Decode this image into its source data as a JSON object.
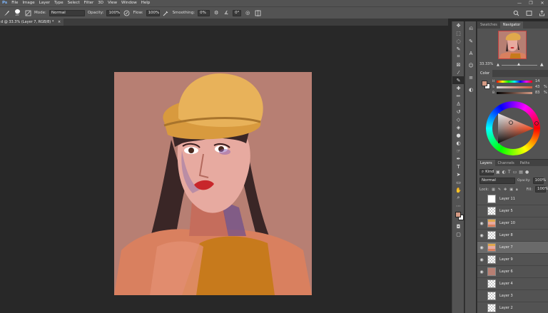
{
  "menu": [
    "File",
    "Image",
    "Layer",
    "Type",
    "Select",
    "Filter",
    "3D",
    "View",
    "Window",
    "Help"
  ],
  "window_controls": [
    "—",
    "❐",
    "✕"
  ],
  "options": {
    "brush_size": "20",
    "mode_label": "Mode:",
    "mode_value": "Normal",
    "opacity_label": "Opacity:",
    "opacity_value": "100%",
    "flow_label": "Flow:",
    "flow_value": "100%",
    "smoothing_label": "Smoothing:",
    "smoothing_value": "0%",
    "angle_value": "0°"
  },
  "document": {
    "tab_title": "d @ 33.3% (Layer 7, RGB/8) *",
    "close": "×"
  },
  "navigator": {
    "tabs": [
      "Swatches",
      "Navigator"
    ],
    "active_tab": "Navigator",
    "zoom": "33.33%"
  },
  "color_panel": {
    "title": "Color",
    "values": [
      {
        "label": "H",
        "value": "14"
      },
      {
        "label": "S",
        "value": "43"
      },
      {
        "label": "B",
        "value": "83"
      }
    ],
    "unit": "%",
    "foreground": "#d49a84",
    "background": "#ffffff"
  },
  "layers_panel": {
    "tabs": [
      "Layers",
      "Channels",
      "Paths"
    ],
    "active_tab": "Layers",
    "kind_label": "Kind",
    "blend_mode": "Normal",
    "opacity_label": "Opacity:",
    "opacity_value": "100%",
    "lock_label": "Lock:",
    "fill_label": "Fill:",
    "fill_value": "100%",
    "layers": [
      {
        "name": "Layer 11",
        "visible": false,
        "thumb": "white"
      },
      {
        "name": "Layer 5",
        "visible": false,
        "thumb": "checker"
      },
      {
        "name": "Layer 10",
        "visible": true,
        "thumb": "portrait"
      },
      {
        "name": "Layer 8",
        "visible": true,
        "thumb": "checker"
      },
      {
        "name": "Layer 7",
        "visible": true,
        "thumb": "portrait",
        "selected": true
      },
      {
        "name": "Layer 9",
        "visible": true,
        "thumb": "checker"
      },
      {
        "name": "Layer 6",
        "visible": true,
        "thumb": "mauve"
      },
      {
        "name": "Layer 4",
        "visible": false,
        "thumb": "checker"
      },
      {
        "name": "Layer 3",
        "visible": false,
        "thumb": "checker"
      },
      {
        "name": "Layer 2",
        "visible": false,
        "thumb": "checker"
      }
    ]
  }
}
